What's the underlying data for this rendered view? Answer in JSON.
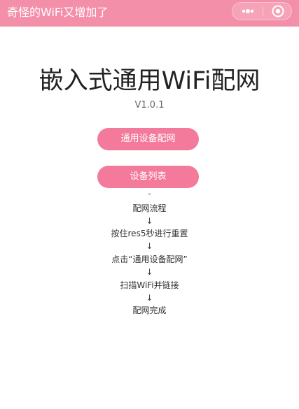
{
  "topbar": {
    "title": "奇怪的WiFi又增加了",
    "color": "#f48fa9",
    "more_icon": "more-dots-icon",
    "close_icon": "target-circle-icon"
  },
  "main": {
    "title": "嵌入式通用WiFi配网",
    "version": "V1.0.1",
    "accent": "#f47a9c"
  },
  "buttons": {
    "config_label": "通用设备配网",
    "list_label": "设备列表"
  },
  "flow": {
    "top_marker": "-",
    "arrow": "↓",
    "steps": [
      "配网流程",
      "按住res5秒进行重置",
      "点击“通用设备配网”",
      "扫描WiFi并链接",
      "配网完成"
    ]
  }
}
